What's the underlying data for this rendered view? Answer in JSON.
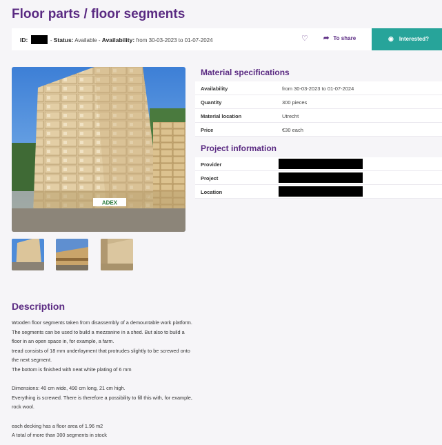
{
  "page": {
    "title": "Floor parts / floor segments"
  },
  "status_bar": {
    "id_label": "ID:",
    "sep1": "- ",
    "status_label": "Status:",
    "status_value": "Available",
    "sep2": " - ",
    "availability_label": "Availability:",
    "availability_value": "from 30-03-2023 to 01-07-2024",
    "share_label": "To share",
    "interested_label": "Interested?"
  },
  "material_specs": {
    "heading": "Material specifications",
    "rows": [
      {
        "key": "Availability",
        "value": "from 30-03-2023 to 01-07-2024"
      },
      {
        "key": "Quantity",
        "value": "300 pieces"
      },
      {
        "key": "Material location",
        "value": "Utrecht"
      },
      {
        "key": "Price",
        "value": "€30 each"
      }
    ]
  },
  "project_info": {
    "heading": "Project information",
    "rows": [
      {
        "key": "Provider"
      },
      {
        "key": "Project"
      },
      {
        "key": "Location"
      }
    ]
  },
  "photo": {
    "brand_text": "ADEX"
  },
  "description": {
    "heading": "Description",
    "lines": [
      "Wooden floor segments taken from disassembly of a demountable work platform.",
      "The segments can be used to build a mezzanine in a shed. But also to build a floor in an open space in, for example, a farm.",
      "tread consists of 18 mm underlayment that protrudes slightly to be screwed onto the next segment.",
      "The bottom is finished with neat white plating of 6 mm",
      "",
      "Dimensions: 40 cm wide, 490 cm long, 21 cm high.",
      "Everything is screwed. There is therefore a possibility to fill this with, for example, rock wool.",
      "",
      "each decking has a floor area of 1.96 m2",
      "A total of more than 300 segments in stock"
    ]
  },
  "colors": {
    "accent": "#5a2a82",
    "cta": "#27a49a"
  },
  "icons": {
    "favorite": "heart-icon",
    "share": "share-arrow-icon",
    "interested": "eye-icon"
  }
}
